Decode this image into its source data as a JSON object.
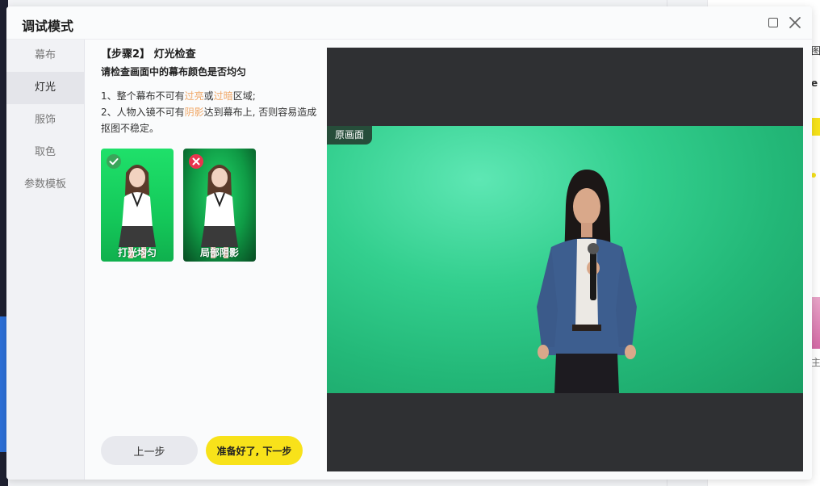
{
  "dialog": {
    "title": "调试模式"
  },
  "sidebar": {
    "items": [
      {
        "label": "幕布"
      },
      {
        "label": "灯光"
      },
      {
        "label": "服饰"
      },
      {
        "label": "取色"
      },
      {
        "label": "参数模板"
      }
    ],
    "active_index": 1
  },
  "panel": {
    "step_title": "【步骤2】 灯光检查",
    "subtitle": "请检查画面中的幕布颜色是否均匀",
    "rule1": {
      "prefix": "1、整个幕布不可有",
      "hl1": "过亮",
      "mid": "或",
      "hl2": "过暗",
      "suffix": "区域;"
    },
    "rule2": {
      "prefix": "2、人物入镜不可有",
      "hl": "阴影",
      "suffix": "达到幕布上, 否则容易造成抠图不稳定。"
    },
    "examples": [
      {
        "caption": "打光均匀",
        "status": "good"
      },
      {
        "caption": "局部阴影",
        "status": "bad"
      }
    ],
    "prev_label": "上一步",
    "next_label": "准备好了, 下一步"
  },
  "preview": {
    "tag": "原画面"
  },
  "background_app": {
    "frag1": "图",
    "frag2": "e",
    "frag3": "主"
  },
  "colors": {
    "accent_yellow": "#f8e21a",
    "highlight_orange": "#f0a868",
    "ok_green": "#3aa55a",
    "error_red": "#e8344e",
    "screen_green": "#23b878"
  }
}
